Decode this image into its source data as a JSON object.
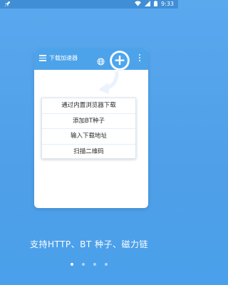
{
  "status_bar": {
    "time": "9:33"
  },
  "card": {
    "app_title": "下载加速器"
  },
  "popup": {
    "items": [
      {
        "label": "通过内置浏览器下载"
      },
      {
        "label": "添加BT种子"
      },
      {
        "label": "输入下载地址"
      },
      {
        "label": "扫描二维码"
      }
    ]
  },
  "tagline": "支持HTTP、BT 种子、磁力链",
  "pager": {
    "active_index": 0,
    "count": 4
  },
  "colors": {
    "background": "#4e9fe8",
    "toolbar": "#4ca3ea",
    "white": "#ffffff"
  },
  "icons": [
    "rocket-icon",
    "wifi-icon",
    "signal-icon",
    "battery-icon",
    "menu-icon",
    "globe-icon",
    "more-vert-icon",
    "plus-icon",
    "arrow-icon"
  ]
}
